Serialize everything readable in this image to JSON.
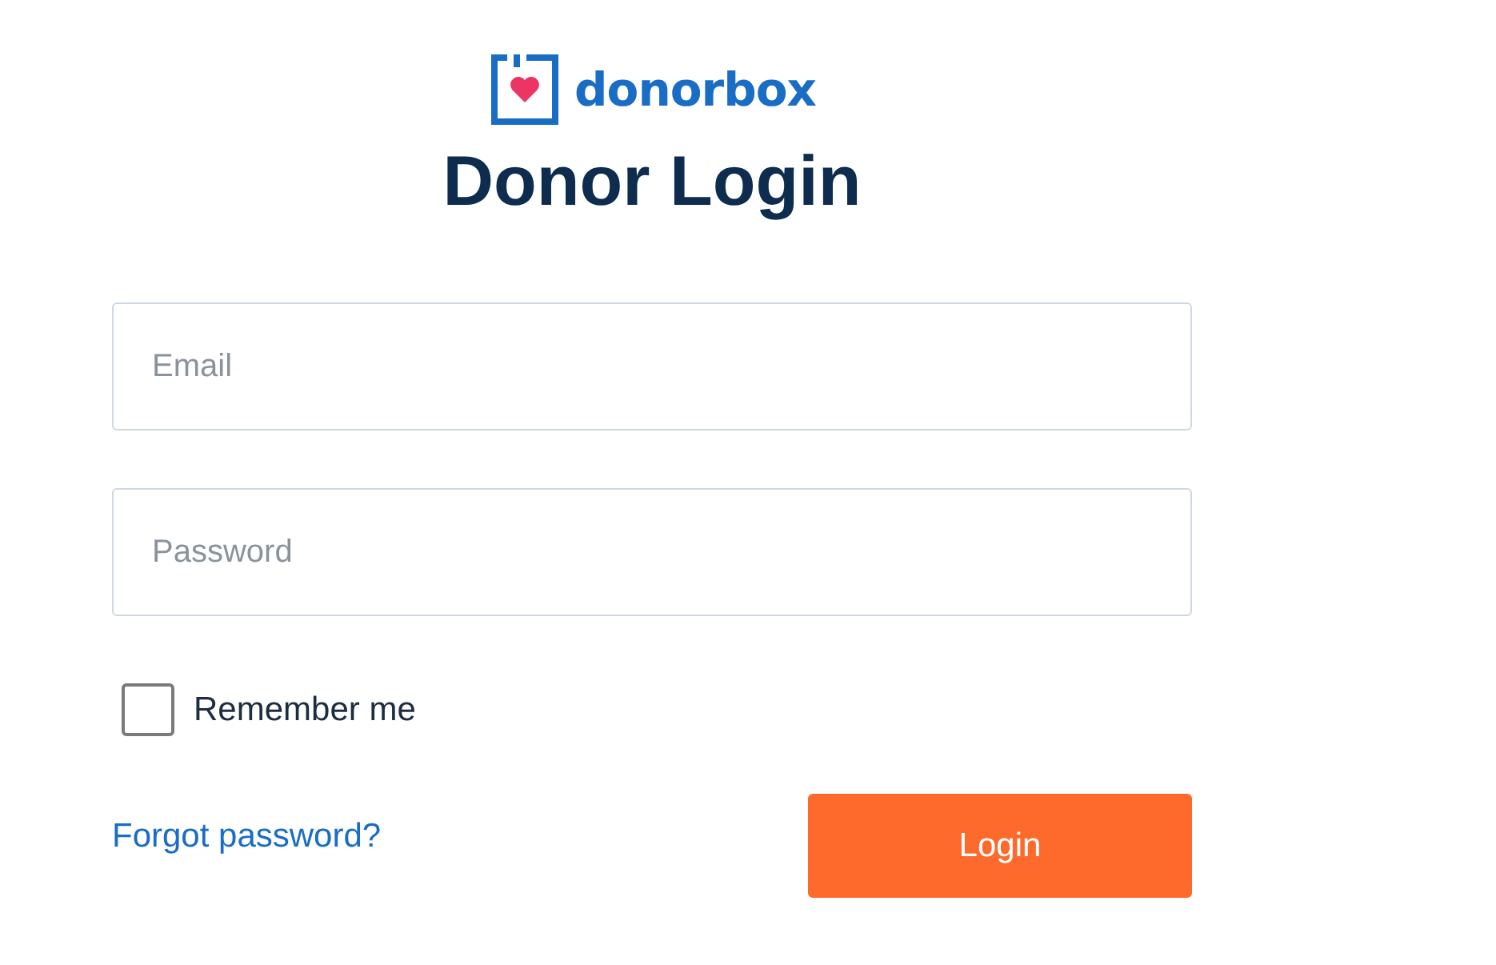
{
  "logo": {
    "text": "donorbox"
  },
  "title": "Donor Login",
  "email_field": {
    "placeholder": "Email"
  },
  "password_field": {
    "placeholder": "Password"
  },
  "remember": {
    "label": "Remember me",
    "checked": false
  },
  "forgot_link": "Forgot password?",
  "login_button": "Login"
}
